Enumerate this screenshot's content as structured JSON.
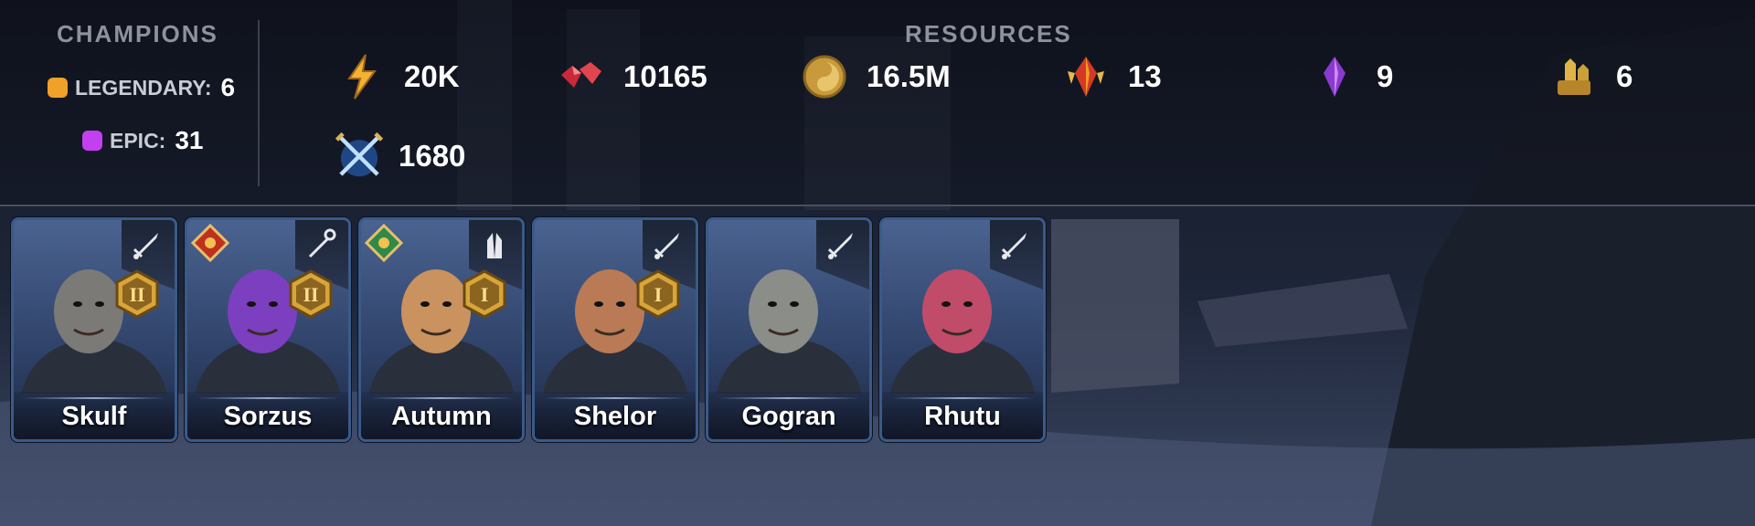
{
  "champions": {
    "title": "CHAMPIONS",
    "legendary": {
      "label": "LEGENDARY:",
      "count": "6",
      "color": "#f0a12a"
    },
    "epic": {
      "label": "EPIC:",
      "count": "31",
      "color": "#c43ff0"
    }
  },
  "resources": {
    "title": "RESOURCES",
    "items": [
      {
        "icon": "energy-bolt-icon",
        "value": "20K"
      },
      {
        "icon": "ruby-gems-icon",
        "value": "10165"
      },
      {
        "icon": "silver-coin-icon",
        "value": "16.5M"
      },
      {
        "icon": "sacred-shard-icon",
        "value": "13"
      },
      {
        "icon": "void-shard-icon",
        "value": "9"
      },
      {
        "icon": "gold-bag-icon",
        "value": "6"
      },
      {
        "icon": "arena-swords-icon",
        "value": "1680"
      }
    ]
  },
  "heroes": [
    {
      "name": "Skulf",
      "role": "attack-sword-icon",
      "rank": "II",
      "affinity": "",
      "skin": "#7b7a76"
    },
    {
      "name": "Sorzus",
      "role": "magic-staff-icon",
      "rank": "II",
      "affinity": "force-affinity-icon",
      "skin": "#7c3fbf"
    },
    {
      "name": "Autumn",
      "role": "support-hands-icon",
      "rank": "I",
      "affinity": "spirit-affinity-icon",
      "skin": "#c9925e"
    },
    {
      "name": "Shelor",
      "role": "attack-sword-icon",
      "rank": "I",
      "affinity": "",
      "skin": "#b97a55"
    },
    {
      "name": "Gogran",
      "role": "attack-sword-icon",
      "rank": "",
      "affinity": "",
      "skin": "#8a8d88"
    },
    {
      "name": "Rhutu",
      "role": "attack-sword-icon",
      "rank": "",
      "affinity": "",
      "skin": "#c04c6a"
    }
  ],
  "colors": {
    "card_border": "#3a5a88",
    "rank_gold": "#d8a53a",
    "title_gray": "#8d929c"
  }
}
